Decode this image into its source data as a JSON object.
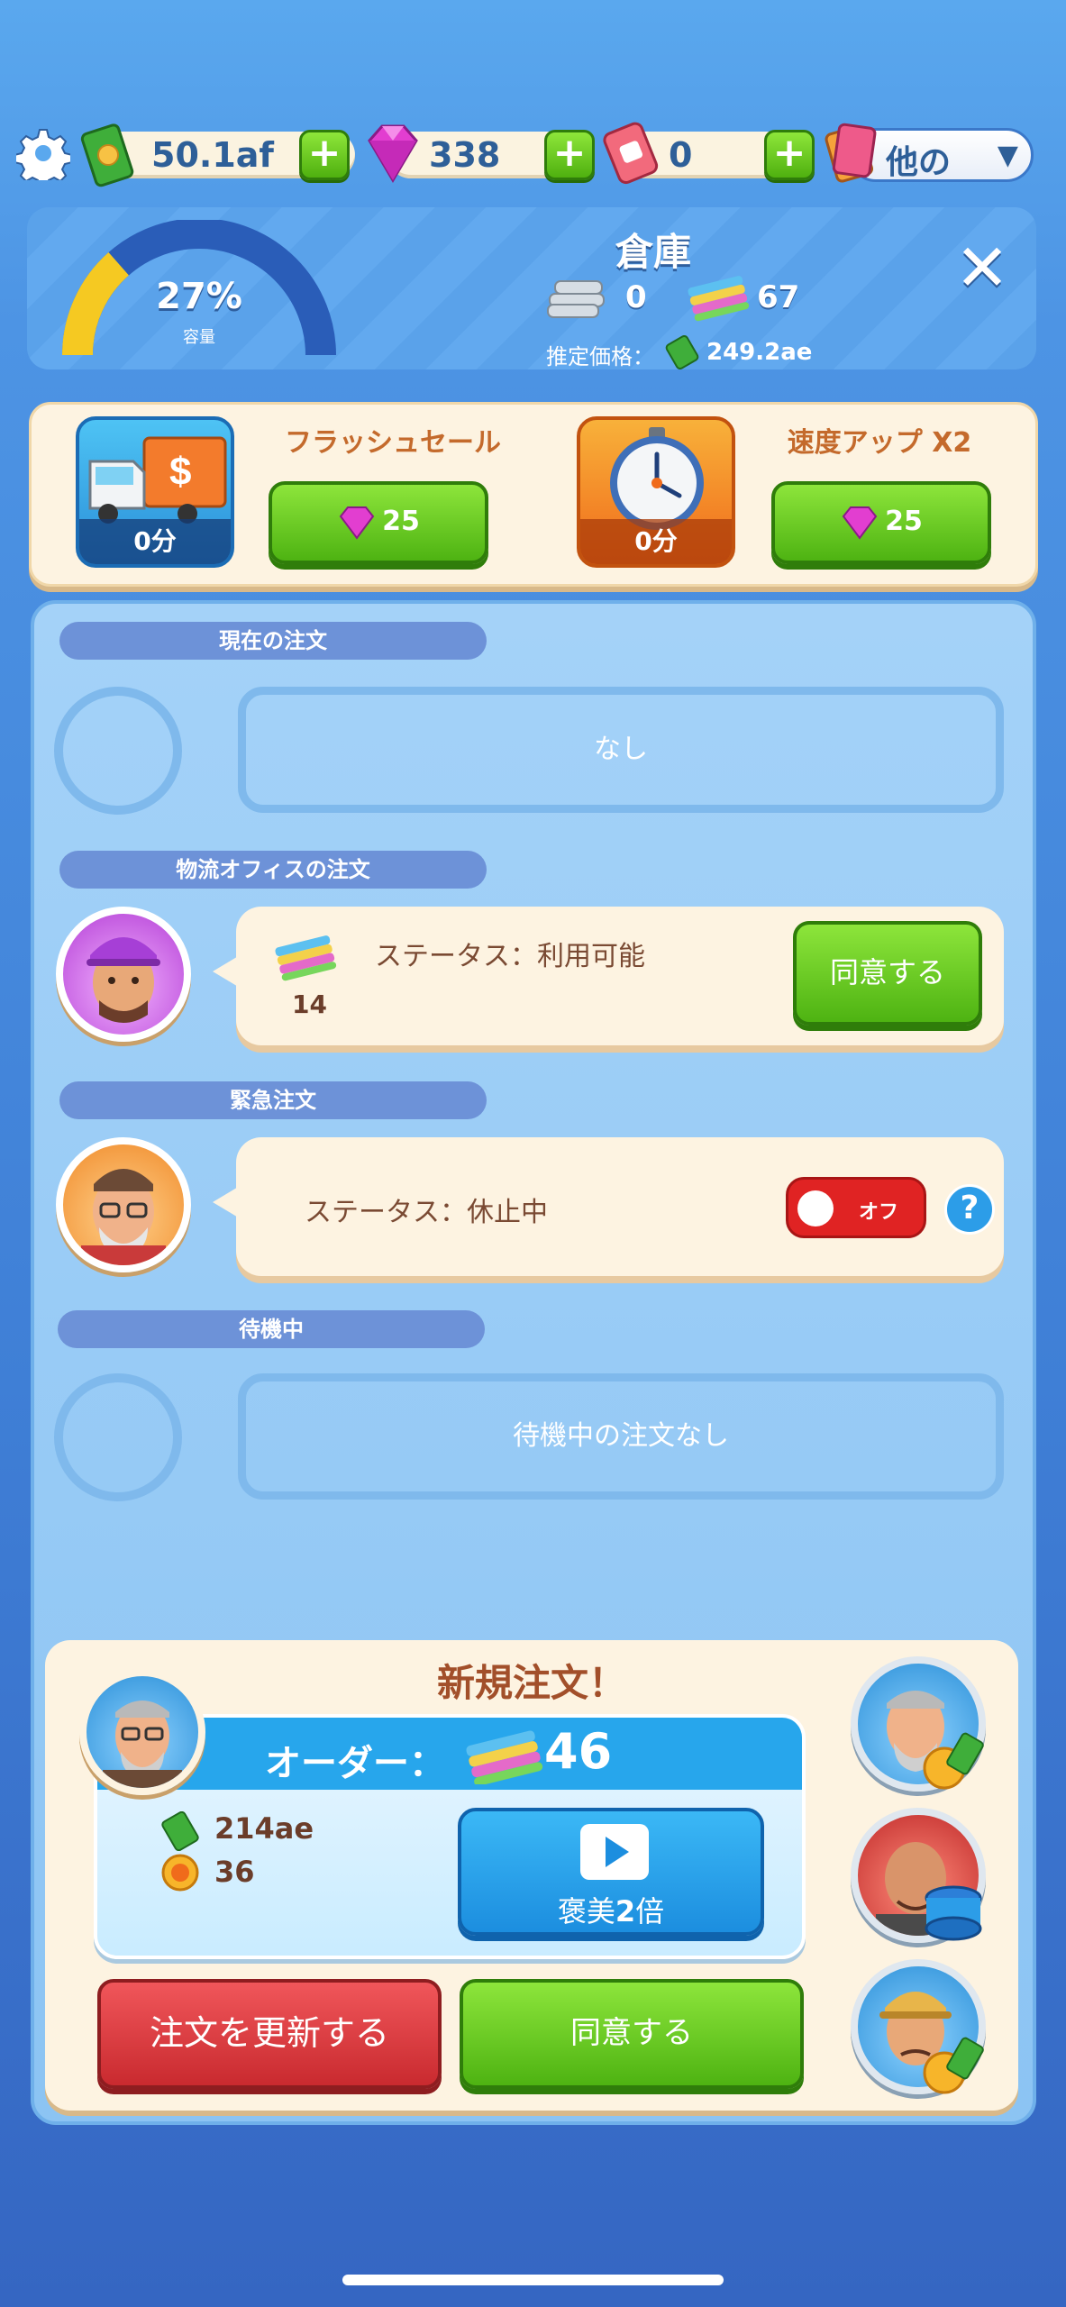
{
  "topbar": {
    "cash_value": "50.1af",
    "gems_value": "338",
    "tickets_value": "0",
    "plus_label": "+",
    "other_label": "他の"
  },
  "warehouse": {
    "title": "倉庫",
    "capacity_percent": "27%",
    "capacity_fraction": 0.27,
    "capacity_label": "容量",
    "metal_count": "0",
    "fabric_count": "67",
    "estimated_label": "推定価格：",
    "estimated_value": "249.2ae",
    "close_label": "✕"
  },
  "boosts": [
    {
      "title": "フラッシュセール",
      "time": "0分",
      "cost": "25"
    },
    {
      "title": "速度アップ X2",
      "time": "0分",
      "cost": "25"
    }
  ],
  "sections": {
    "current": {
      "label": "現在の注文",
      "empty_text": "なし"
    },
    "logistics": {
      "label": "物流オフィスの注文",
      "quantity": "14",
      "status": "ステータス：利用可能",
      "accept": "同意する"
    },
    "urgent": {
      "label": "緊急注文",
      "status": "ステータス：休止中",
      "toggle": "オフ",
      "help": "?"
    },
    "waiting": {
      "label": "待機中",
      "empty_text": "待機中の注文なし"
    }
  },
  "new_order": {
    "title": "新規注文！",
    "order_label": "オーダー：",
    "order_quantity": "46",
    "reward_cash": "214ae",
    "reward_coins": "36",
    "double_label_prefix": "褒美",
    "double_label_strong": "2",
    "double_label_suffix": "倍",
    "refresh": "注文を更新する",
    "accept": "同意する"
  },
  "colors": {
    "accent_green": "#4eb312",
    "accent_red": "#c92a2f",
    "accent_blue": "#27a6ec"
  }
}
